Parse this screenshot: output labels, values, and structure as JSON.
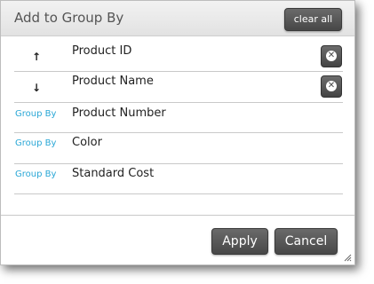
{
  "dialog": {
    "title": "Add to Group By",
    "clear_all_label": "clear all",
    "sorted_rows": [
      {
        "arrow": "↑",
        "field": "Product ID"
      },
      {
        "arrow": "↓",
        "field": "Product Name"
      }
    ],
    "group_by_rows": [
      {
        "link": "Group By",
        "field": "Product Number"
      },
      {
        "link": "Group By",
        "field": "Color"
      },
      {
        "link": "Group By",
        "field": "Standard Cost"
      }
    ],
    "apply_label": "Apply",
    "cancel_label": "Cancel"
  }
}
